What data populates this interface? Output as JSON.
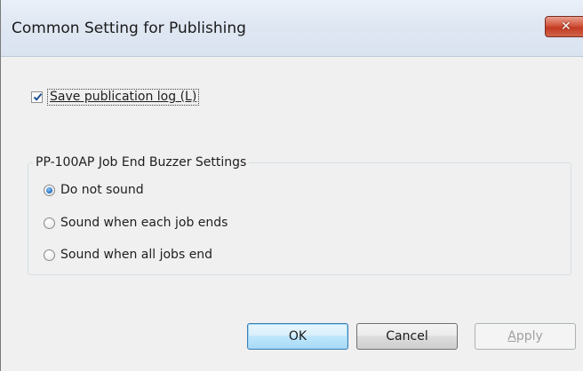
{
  "window": {
    "title": "Common Setting for Publishing",
    "close_glyph": "✕"
  },
  "log": {
    "checked": true,
    "label": "Save publication log (L)"
  },
  "buzzer_group": {
    "legend": "PP-100AP Job End Buzzer Settings",
    "options": [
      {
        "label": "Do not sound",
        "selected": true
      },
      {
        "label": "Sound when each job ends",
        "selected": false
      },
      {
        "label": "Sound when all jobs end",
        "selected": false
      }
    ]
  },
  "buttons": {
    "ok": "OK",
    "cancel": "Cancel",
    "apply_first": "A",
    "apply_rest": "pply"
  },
  "colors": {
    "close_button": "#c33a22",
    "radio_selected": "#2a78c8",
    "default_button_border": "#3c7fb1"
  }
}
